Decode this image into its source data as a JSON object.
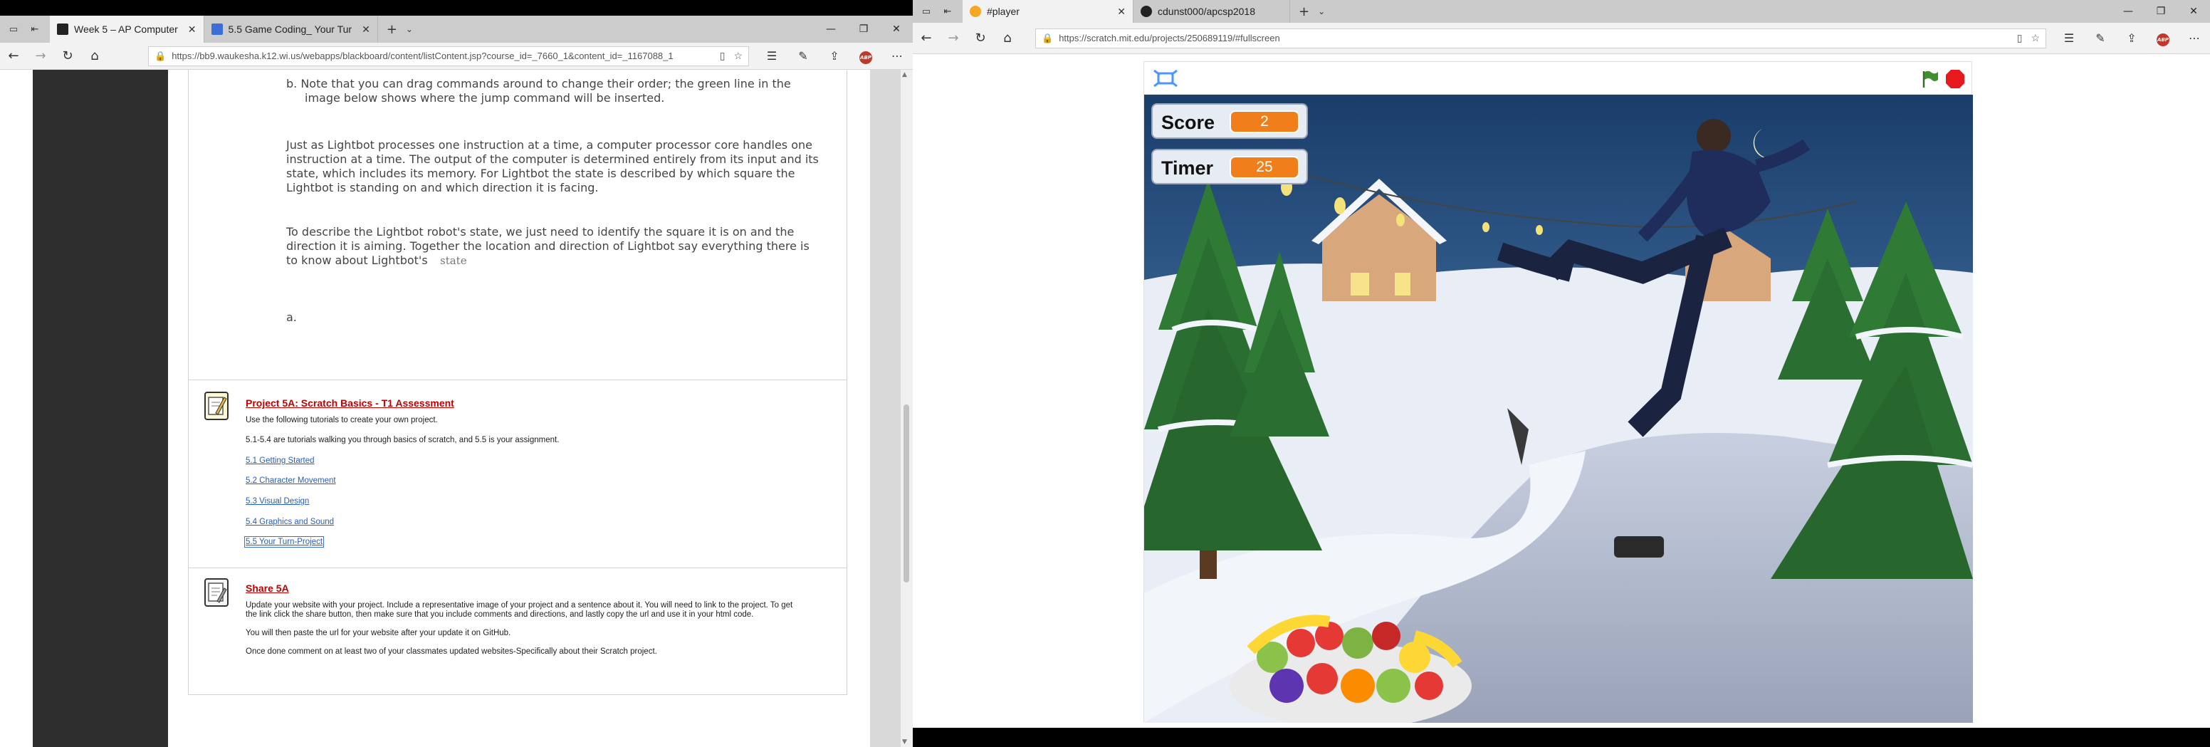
{
  "left_window": {
    "tabs": [
      {
        "label": "Week 5 – AP Computer",
        "active": true
      },
      {
        "label": "5.5 Game Coding_ Your Tur",
        "active": false
      }
    ],
    "url": "https://bb9.waukesha.k12.wi.us/webapps/blackboard/content/listContent.jsp?course_id=_7660_1&content_id=_1167088_1",
    "content": {
      "step_b": "b.  Note that you can drag commands around to change their order; the green line in the",
      "step_b_2": "image below shows where the jump command will be inserted.",
      "para1_l1": "Just as Lightbot processes one instruction at a time, a computer processor core handles one",
      "para1_l2": "instruction at a time. The output of the computer is determined entirely from its input and its",
      "para1_l3": "state, which includes its memory. For Lightbot the state is described by which square the",
      "para1_l4": "Lightbot is standing on and which direction it is facing.",
      "para2_l1": "To describe the Lightbot robot's state, we just need to identify the square it is on and the",
      "para2_l2": "direction it is aiming. Together the location and direction of Lightbot say everything there is",
      "para2_l3": "to know about Lightbot's",
      "para2_state": "state",
      "step_a": "a."
    },
    "project": {
      "title": "Project 5A: Scratch Basics - T1 Assessment",
      "line1": "Use the following tutorials to create your own project.",
      "line2": "5.1-5.4 are tutorials walking you through basics of scratch, and 5.5 is your assignment.",
      "links": [
        "5.1 Getting Started",
        "5.2 Character Movement",
        "5.3 Visual Design",
        "5.4 Graphics and Sound",
        "5.5 Your Turn-Project"
      ]
    },
    "share": {
      "title": "Share 5A",
      "line1": "Update your website with your project. Include a representative image of your project and a sentence about it. You will need to link to the project.  To get",
      "line2": "the link click the share button, then make sure that you include comments and directions, and lastly copy the url and use it in your html code.",
      "line3": "You will then paste the url for your website after your update it on GitHub.",
      "line4": "Once done comment on at least two of your classmates updated websites-Specifically about their Scratch project."
    }
  },
  "right_window": {
    "tabs": [
      {
        "label": "#player",
        "active": true
      },
      {
        "label": "cdunst000/apcsp2018",
        "active": false
      }
    ],
    "url": "https://scratch.mit.edu/projects/250689119/#fullscreen",
    "game": {
      "score_label": "Score",
      "score_value": "2",
      "timer_label": "Timer",
      "timer_value": "25"
    }
  },
  "colors": {
    "link": "#2a5db0",
    "title_red": "#c00000",
    "scratch_orange": "#f07f1b",
    "stop_red": "#e6191c",
    "flag_green": "#3f8f2f"
  }
}
